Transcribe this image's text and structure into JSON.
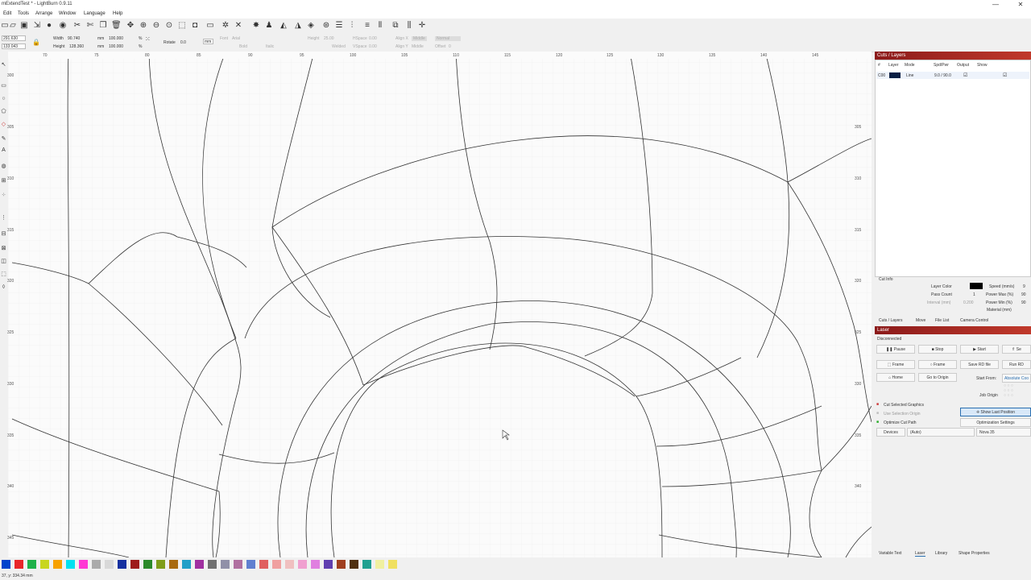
{
  "window": {
    "title": "mExtendTest * - LightBurn 0.9.11",
    "minimize": "—",
    "close": "✕"
  },
  "menu": [
    "Edit",
    "Tools",
    "Arrange",
    "Window",
    "Language",
    "Help"
  ],
  "props": {
    "x": "291.630",
    "y": "133.043",
    "width_label": "Width",
    "width": "90.740",
    "height_label": "Height",
    "height": "128.360",
    "unit": "mm",
    "pct1": "100.000",
    "pct2": "100.000",
    "pct": "%",
    "rotate_label": "Rotate",
    "rotate": "0.0",
    "rot_unit": "mm",
    "font_label": "Font",
    "font": "Arial",
    "height_t_label": "Height",
    "height_t": "25.00",
    "hspace_label": "HSpace",
    "hspace": "0.00",
    "vspace_label": "VSpace",
    "vspace": "0.00",
    "alignx_label": "Align X",
    "alignx": "Middle",
    "aligny_label": "Align Y",
    "aligny": "Middle",
    "normal": "Normal",
    "offset_label": "Offset",
    "offset": "0",
    "bold": "Bold",
    "italic": "Italic",
    "upper": "Upper Case",
    "welded": "Welded",
    "distort": "Distort"
  },
  "ruler": {
    "top": [
      "70",
      "75",
      "80",
      "85",
      "90",
      "95",
      "100",
      "105",
      "110",
      "115",
      "120",
      "125",
      "130",
      "135",
      "140",
      "145"
    ],
    "left": [
      "300",
      "305",
      "310",
      "315",
      "320",
      "325",
      "330",
      "335",
      "340",
      "345"
    ],
    "right": [
      "305",
      "310",
      "315",
      "320",
      "325",
      "330",
      "335",
      "340"
    ]
  },
  "palette": [
    "#0044cc",
    "#e8262a",
    "#1fb14a",
    "#c8d61e",
    "#f7a100",
    "#00e0f0",
    "#ff38d4",
    "#aaaaaa",
    "#d8d8d8",
    "#1530a0",
    "#9e1a1a",
    "#2a8a2a",
    "#7f9d1a",
    "#a86a10",
    "#20a0c8",
    "#a030a0",
    "#707070",
    "#9090a8",
    "#b070a0",
    "#6080d0",
    "#e06060",
    "#f0a0a0",
    "#f0c0c0",
    "#f0a0d0",
    "#e080e0",
    "#6040b0",
    "#a04020",
    "#503010",
    "#20a090",
    "#f0f0a0",
    "#f0e060"
  ],
  "status": "37, y: 334.34 mm",
  "panel": {
    "cuts_title": "Cuts / Layers",
    "columns": [
      "#",
      "Layer",
      "Mode",
      "Spd/Pwr",
      "Output",
      "Show"
    ],
    "layer": {
      "num": "C00",
      "color": "#0a1f44",
      "mode": "Line",
      "spdpwr": "9.0 / 90.0"
    },
    "cut_info": "Cut Info",
    "layer_color_label": "Layer Color",
    "speed_label": "Speed (mm/s)",
    "speed": "9",
    "pass_label": "Pass Count",
    "pass": "1",
    "pmax_label": "Power Max (%)",
    "pmax": "90",
    "interval_label": "Interval (mm)",
    "interval": "0.200",
    "pmin_label": "Power Min (%)",
    "pmin": "90",
    "material_label": "Material (mm)",
    "tabs": [
      "Cuts / Layers",
      "Move",
      "File List",
      "Camera Control"
    ],
    "laser_title": "Laser",
    "disconnected": "Disconnected",
    "pause": "Pause",
    "stop": "Stop",
    "start": "Start",
    "send": "Se",
    "frame1": "Frame",
    "frame2": "Frame",
    "save_rd": "Save RD file",
    "run_rd": "Run RD",
    "home": "Home",
    "goto": "Go to Origin",
    "start_from_label": "Start From:",
    "start_from": "Absolute Coo",
    "job_origin": "Job Origin",
    "cut_selected": "Cut Selected Graphics",
    "use_selection": "Use Selection Origin",
    "optimize": "Optimize Cut Path",
    "show_last": "Show Last Position",
    "opt_settings": "Optimization Settings",
    "devices": "Devices",
    "auto": "(Auto)",
    "device_name": "Nova 35",
    "bottom_tabs": [
      "Variable Text",
      "Laser",
      "Library",
      "Shape Properties"
    ]
  }
}
